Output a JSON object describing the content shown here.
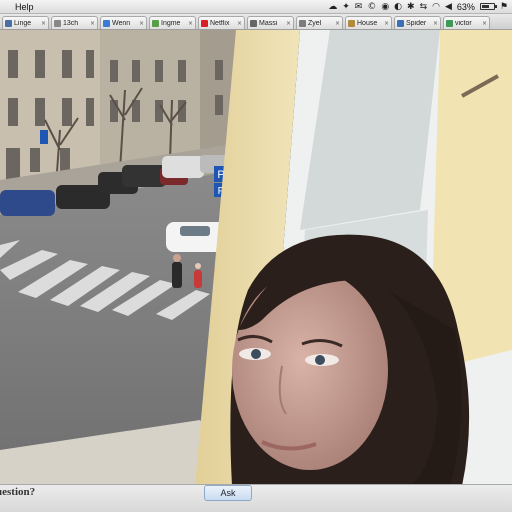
{
  "menubar": {
    "items": [
      "Help"
    ],
    "status": {
      "battery_percent_label": "63%",
      "battery_level": 0.63,
      "icons": [
        "cloud-icon",
        "dropbox-icon",
        "mail-icon",
        "copyright-icon",
        "camera-icon",
        "speaker-icon",
        "bluetooth-icon",
        "vpn-icon",
        "wifi-icon",
        "volume-icon",
        "battery-icon",
        "flag-icon"
      ]
    }
  },
  "tabs": [
    {
      "label": "Linge",
      "fav_color": "#4a6fa5"
    },
    {
      "label": "13ch",
      "fav_color": "#888888"
    },
    {
      "label": "Wenn",
      "fav_color": "#3a7bd5"
    },
    {
      "label": "Ingme",
      "fav_color": "#5a9e4b"
    },
    {
      "label": "Netflix",
      "fav_color": "#d81f26"
    },
    {
      "label": "Massi",
      "fav_color": "#666666"
    },
    {
      "label": "Zyel",
      "fav_color": "#7c7c7c"
    },
    {
      "label": "House",
      "fav_color": "#b08a3e"
    },
    {
      "label": "Spider",
      "fav_color": "#3d6fb6"
    },
    {
      "label": "victor",
      "fav_color": "#3b9a55"
    }
  ],
  "askbar": {
    "question_text": "uestion?",
    "ask_label": "Ask"
  },
  "scene": {
    "sign_letters": [
      "P",
      "P"
    ],
    "colors": {
      "sky_building": "#cbc2b3",
      "road": "#7d7d7d",
      "wall": "#e9d9a8",
      "window_frame": "#ebeeee",
      "hair": "#2a1f1a",
      "skin": "#caa39a"
    }
  }
}
